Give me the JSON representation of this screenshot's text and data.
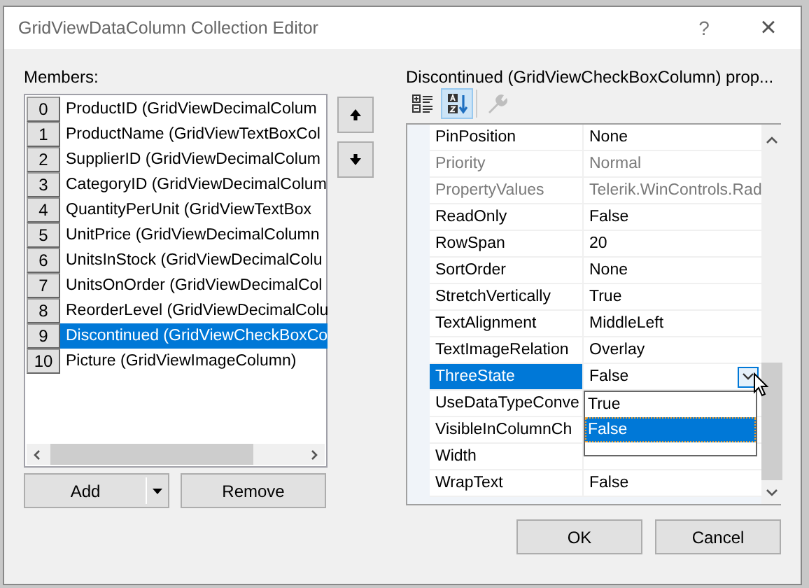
{
  "window": {
    "title": "GridViewDataColumn Collection Editor",
    "help": "?",
    "close": "×"
  },
  "members": {
    "label": "Members:",
    "items": [
      {
        "index": "0",
        "text": "ProductID (GridViewDecimalColum",
        "selected": false
      },
      {
        "index": "1",
        "text": "ProductName (GridViewTextBoxCol",
        "selected": false
      },
      {
        "index": "2",
        "text": "SupplierID (GridViewDecimalColum",
        "selected": false
      },
      {
        "index": "3",
        "text": "CategoryID (GridViewDecimalColum",
        "selected": false
      },
      {
        "index": "4",
        "text": "QuantityPerUnit (GridViewTextBox",
        "selected": false
      },
      {
        "index": "5",
        "text": "UnitPrice (GridViewDecimalColumn",
        "selected": false
      },
      {
        "index": "6",
        "text": "UnitsInStock (GridViewDecimalColu",
        "selected": false
      },
      {
        "index": "7",
        "text": "UnitsOnOrder (GridViewDecimalCol",
        "selected": false
      },
      {
        "index": "8",
        "text": "ReorderLevel (GridViewDecimalColu",
        "selected": false
      },
      {
        "index": "9",
        "text": "Discontinued (GridViewCheckBoxCo",
        "selected": true
      },
      {
        "index": "10",
        "text": "Picture (GridViewImageColumn)",
        "selected": false
      }
    ],
    "add_button": "Add",
    "remove_button": "Remove"
  },
  "properties": {
    "label": "Discontinued (GridViewCheckBoxColumn) prop...",
    "toolbar": [
      {
        "kind": "categorized",
        "selected": false,
        "disabled": false
      },
      {
        "kind": "alphabetical",
        "selected": true,
        "disabled": false
      },
      {
        "kind": "property-pages",
        "selected": false,
        "disabled": true
      }
    ],
    "rows": [
      {
        "name": "PinPosition",
        "value": "None",
        "disabled": false,
        "selected": false
      },
      {
        "name": "Priority",
        "value": "Normal",
        "disabled": true,
        "selected": false
      },
      {
        "name": "PropertyValues",
        "value": "Telerik.WinControls.Rad",
        "disabled": true,
        "selected": false
      },
      {
        "name": "ReadOnly",
        "value": "False",
        "disabled": false,
        "selected": false
      },
      {
        "name": "RowSpan",
        "value": "20",
        "disabled": false,
        "selected": false
      },
      {
        "name": "SortOrder",
        "value": "None",
        "disabled": false,
        "selected": false
      },
      {
        "name": "StretchVertically",
        "value": "True",
        "disabled": false,
        "selected": false
      },
      {
        "name": "TextAlignment",
        "value": "MiddleLeft",
        "disabled": false,
        "selected": false
      },
      {
        "name": "TextImageRelation",
        "value": "Overlay",
        "disabled": false,
        "selected": false
      },
      {
        "name": "ThreeState",
        "value": "False",
        "disabled": false,
        "selected": true
      },
      {
        "name": "UseDataTypeConve",
        "value": "",
        "disabled": false,
        "selected": false
      },
      {
        "name": "VisibleInColumnCh",
        "value": "",
        "disabled": false,
        "selected": false
      },
      {
        "name": "Width",
        "value": "",
        "disabled": false,
        "selected": false
      },
      {
        "name": "WrapText",
        "value": "False",
        "disabled": false,
        "selected": false
      }
    ],
    "dropdown": {
      "open": true,
      "options": [
        {
          "text": "True",
          "selected": false
        },
        {
          "text": "False",
          "selected": true
        }
      ]
    }
  },
  "buttons": [
    {
      "label": "OK"
    },
    {
      "label": "Cancel"
    }
  ]
}
